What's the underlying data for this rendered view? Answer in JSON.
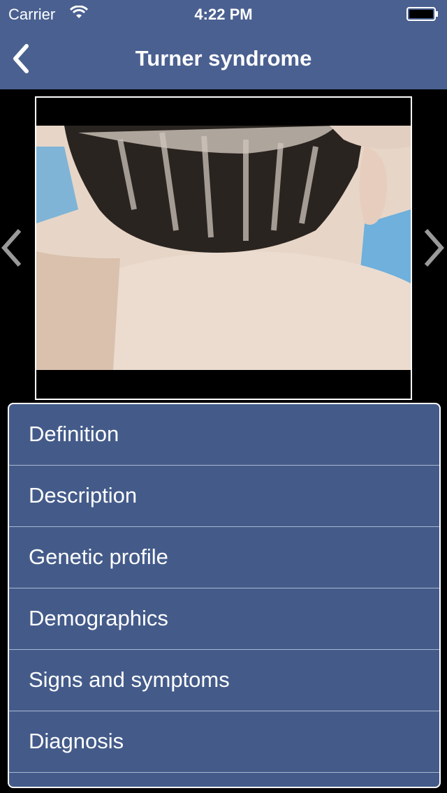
{
  "status_bar": {
    "carrier": "Carrier",
    "time": "4:22 PM"
  },
  "nav": {
    "title": "Turner syndrome",
    "back_icon": "chevron-left-icon"
  },
  "gallery": {
    "image_alt": "Turner syndrome photo",
    "prev_icon": "chevron-left-icon",
    "next_icon": "chevron-right-icon"
  },
  "menu": {
    "items": [
      {
        "label": "Definition"
      },
      {
        "label": "Description"
      },
      {
        "label": "Genetic profile"
      },
      {
        "label": "Demographics"
      },
      {
        "label": "Signs and symptoms"
      },
      {
        "label": "Diagnosis"
      }
    ]
  },
  "colors": {
    "nav_bar": "#4a6090",
    "menu_bg": "#445b8a",
    "separator": "#a9b6cf"
  }
}
